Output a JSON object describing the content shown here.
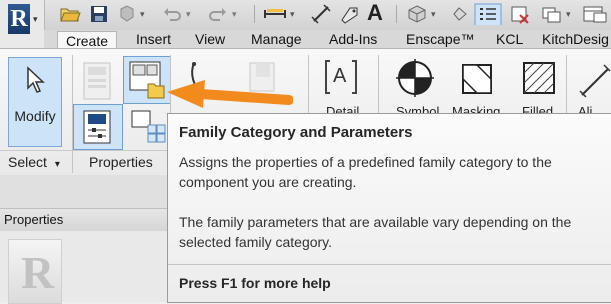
{
  "tabs": [
    "Create",
    "Insert",
    "View",
    "Manage",
    "Add-Ins",
    "Enscape™",
    "KCL",
    "KitchDesig"
  ],
  "ribbon": {
    "modify_label": "Modify",
    "select_panel_label": "Select",
    "properties_panel_label": "Properties",
    "detail_label_partial": "Detail",
    "symbol_label_partial": "Symbol",
    "masking_label_partial": "Masking",
    "filled_label_partial": "Filled",
    "align_label_partial": "Ali",
    "text_tool_glyph": "A",
    "detail_glyph": "A"
  },
  "qat": {
    "app_letter": "R",
    "text_glyph": "A"
  },
  "properties_palette": {
    "title": "Properties",
    "preview_letter": "R"
  },
  "tooltip": {
    "title": "Family Category and Parameters",
    "line1": "Assigns the properties of a predefined family category to the",
    "line2": "component you are creating.",
    "line3": "The family parameters that are available vary depending on the",
    "line4": "selected family category.",
    "help": "Press F1 for more help"
  },
  "colors": {
    "arrow": "#f28a1e",
    "active_highlight": "#cde3f7",
    "app_button": "#1f4a85"
  }
}
